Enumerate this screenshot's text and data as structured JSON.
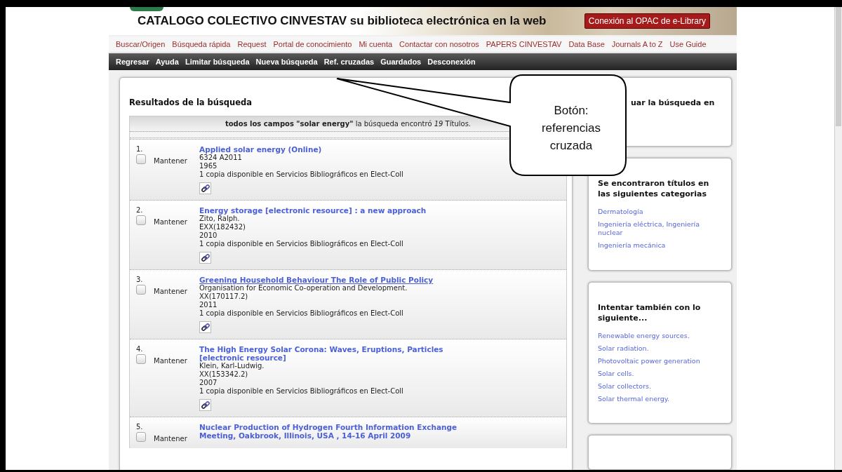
{
  "header": {
    "title": "CATALOGO COLECTIVO CINVESTAV su biblioteca electrónica en la web",
    "opac_button": "Conexión al OPAC de e-Library"
  },
  "top_nav": [
    "Buscar/Origen",
    "Búsqueda rápida",
    "Request",
    "Portal de conocimiento",
    "Mi cuenta",
    "Contactar con nosotros",
    "PAPERS CINVESTAV",
    "Data Base",
    "Journals A to Z",
    "Use Guide"
  ],
  "action_nav": [
    "Regresar",
    "Ayuda",
    "Limitar búsqueda",
    "Nueva búsqueda",
    "Ref. cruzadas",
    "Guardados",
    "Desconexión"
  ],
  "results": {
    "title": "Resultados de la búsqueda",
    "summary": "**todos los campos \"solar energy\"** la búsqueda encontró *19* Títulos.",
    "items": [
      {
        "number": "1.",
        "keep_label": "Mantener",
        "checked": false,
        "title": "Applied solar energy (Online)",
        "hovered": false,
        "details": [
          "6324 A2011",
          "1965",
          "1 copia disponible en Servicios Bibliográficos en Elect-Coll"
        ]
      },
      {
        "number": "2.",
        "keep_label": "Mantener",
        "checked": false,
        "title": "Energy storage [electronic resource] : a new approach",
        "hovered": false,
        "details": [
          "Zito, Ralph.",
          "EXX(182432)",
          "2010",
          "1 copia disponible en Servicios Bibliográficos en Elect-Coll"
        ]
      },
      {
        "number": "3.",
        "keep_label": "Mantener",
        "checked": false,
        "title": "Greening Household Behaviour The Role of Public Policy",
        "hovered": true,
        "details": [
          "Organisation for Economic Co-operation and Development.",
          "XX(170117.2)",
          "2011",
          "1 copia disponible en Servicios Bibliográficos en Elect-Coll"
        ]
      },
      {
        "number": "4.",
        "keep_label": "Mantener",
        "checked": false,
        "title": "The High Energy Solar Corona: Waves, Eruptions, Particles [electronic resource]",
        "hovered": false,
        "details": [
          "Klein, Karl-Ludwig.",
          "XX(153342.2)",
          "2007",
          "1 copia disponible en Servicios Bibliográficos en Elect-Coll"
        ]
      },
      {
        "number": "5.",
        "keep_label": "Mantener",
        "checked": false,
        "title": "Nuclear Production of Hydrogen Fourth Information Exchange Meeting, Oakbrook, Illinois, USA , 14-16 April 2009",
        "hovered": false
      }
    ]
  },
  "sidebar": [
    {
      "title": "uar la búsqueda en"
    },
    {
      "title": "Se encontraron títulos en las siguientes categorias",
      "links": [
        "Dermatología",
        "Ingeniería eléctrica, Ingeniería nuclear",
        "Ingeniería mecánica"
      ]
    },
    {
      "title": "Intentar también con lo siguiente...",
      "links": [
        "Renewable energy sources.",
        "Solar radiation.",
        "Photovoltaic power generation",
        "Solar cells.",
        "Solar collectors.",
        "Solar thermal energy."
      ]
    }
  ],
  "callout": {
    "text": "Botón: referencias cruzada"
  }
}
